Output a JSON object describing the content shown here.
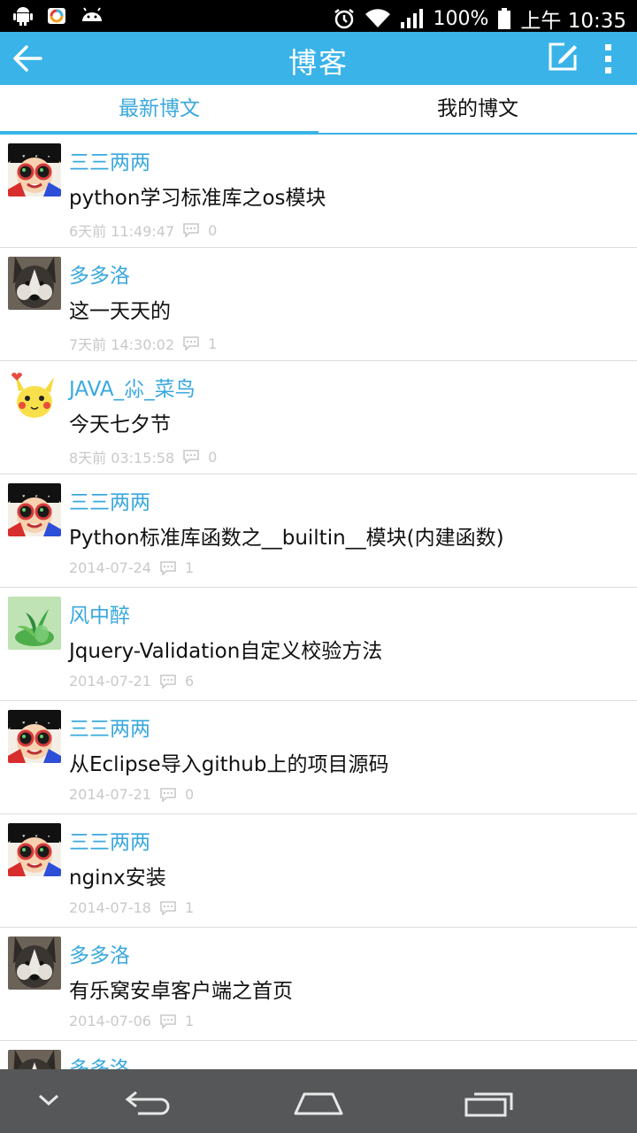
{
  "status_bar": {
    "battery": "100%",
    "time": "上午 10:35",
    "icons": [
      "android-icon",
      "photos-icon",
      "android-alt-icon",
      "alarm-icon",
      "wifi-icon",
      "signal-icon",
      "battery-icon"
    ]
  },
  "app_bar": {
    "title": "博客",
    "icons": [
      "back-arrow-icon",
      "edit-icon",
      "overflow-menu-icon"
    ],
    "color": "#3ab3e8"
  },
  "tabs": [
    {
      "label": "最新博文",
      "active": true
    },
    {
      "label": "我的博文",
      "active": false
    }
  ],
  "posts": [
    {
      "author": "三三两两",
      "title": "python学习标准库之os模块",
      "date": "6天前  11:49:47",
      "comments": "0",
      "avatar": "cartoon-goggles"
    },
    {
      "author": "多多洛",
      "title": "这一天天的",
      "date": "7天前  14:30:02",
      "comments": "1",
      "avatar": "husky-dog"
    },
    {
      "author": "JAVA_尛_菜鸟",
      "title": "今天七夕节",
      "date": "8天前  03:15:58",
      "comments": "0",
      "avatar": "pikachu"
    },
    {
      "author": "三三两两",
      "title": "Python标准库函数之__builtin__模块(内建函数)",
      "date": "2014-07-24",
      "comments": "1",
      "avatar": "cartoon-goggles"
    },
    {
      "author": "风中醉",
      "title": "Jquery-Validation自定义校验方法",
      "date": "2014-07-21",
      "comments": "6",
      "avatar": "green-plant"
    },
    {
      "author": "三三两两",
      "title": "从Eclipse导入github上的项目源码",
      "date": "2014-07-21",
      "comments": "0",
      "avatar": "cartoon-goggles"
    },
    {
      "author": "三三两两",
      "title": "nginx安装",
      "date": "2014-07-18",
      "comments": "1",
      "avatar": "cartoon-goggles"
    },
    {
      "author": "多多洛",
      "title": "有乐窝安卓客户端之首页",
      "date": "2014-07-06",
      "comments": "1",
      "avatar": "husky-dog"
    },
    {
      "author": "多多洛",
      "title": "",
      "date": "",
      "comments": "",
      "avatar": "husky-dog"
    }
  ],
  "nav_bar": {
    "icons": [
      "chevron-down-icon",
      "back-icon",
      "home-icon",
      "recents-icon"
    ]
  }
}
